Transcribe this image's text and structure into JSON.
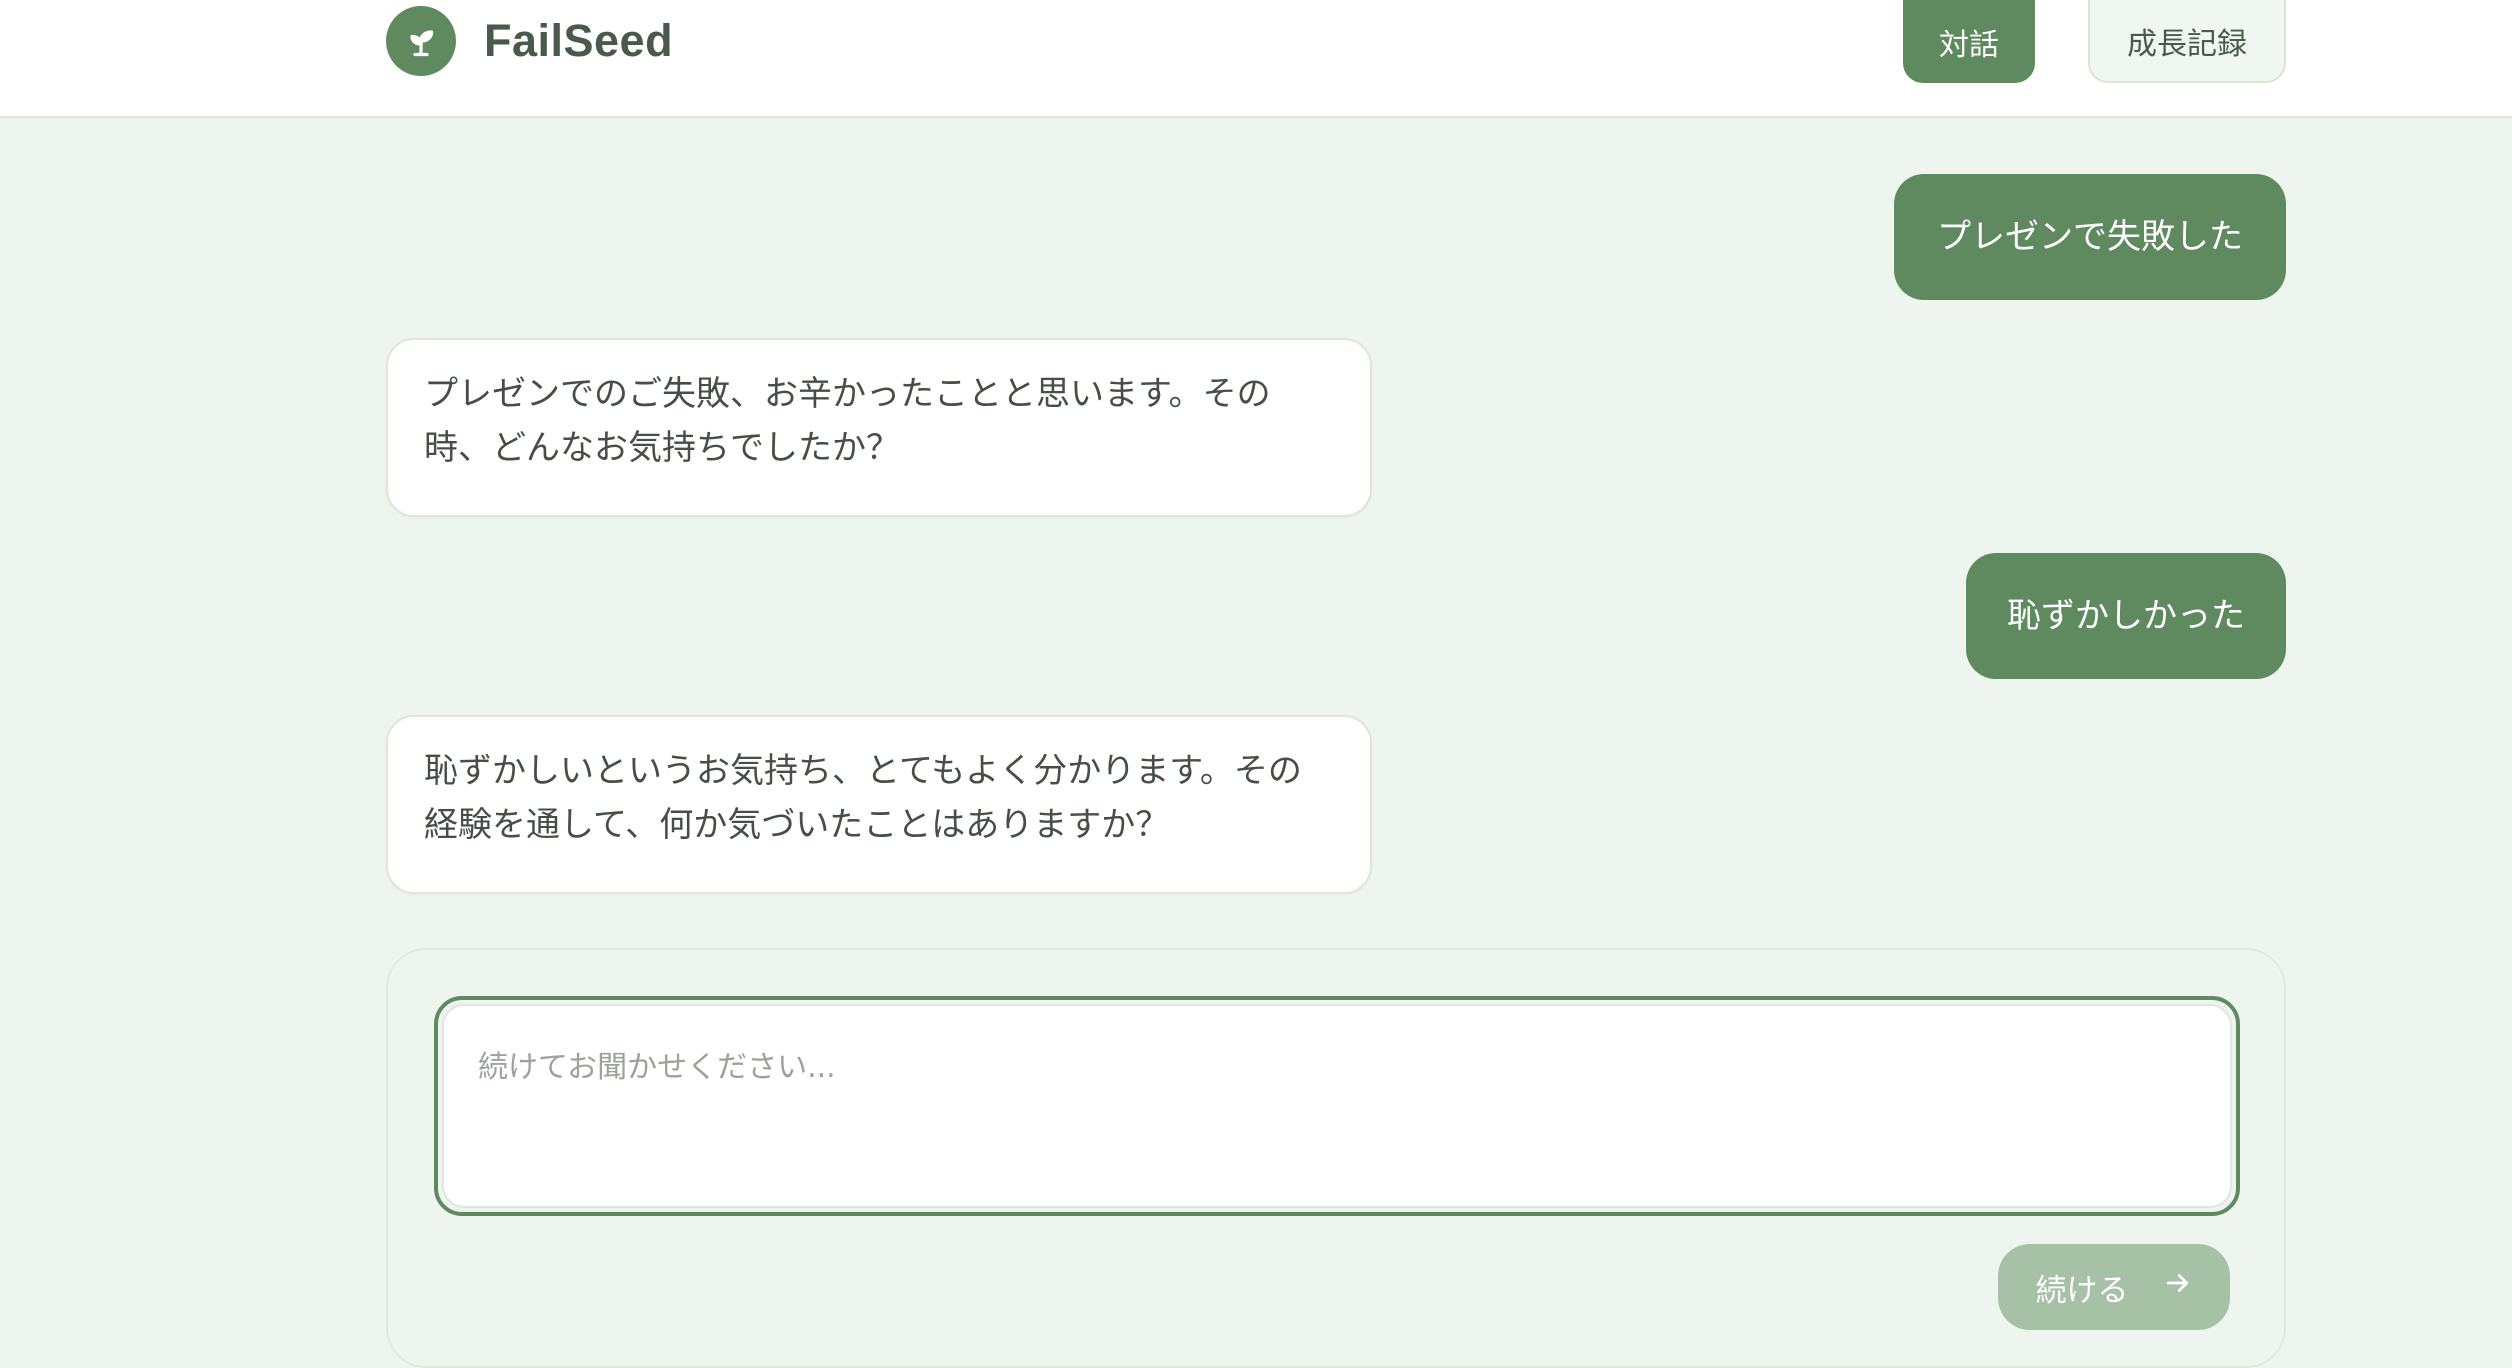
{
  "header": {
    "brand": "FailSeed",
    "logo_icon": "sprout-icon",
    "nav": [
      {
        "label": "対話",
        "active": true
      },
      {
        "label": "成長記録",
        "active": false
      }
    ]
  },
  "messages": [
    {
      "role": "user",
      "text": "プレゼンで失敗した"
    },
    {
      "role": "assistant",
      "text": "プレゼンでのご失敗、お辛かったことと思います。その時、どんなお気持ちでしたか？"
    },
    {
      "role": "user",
      "text": "恥ずかしかった"
    },
    {
      "role": "assistant",
      "text": "恥ずかしいというお気持ち、とてもよく分かります。その経験を通して、何か気づいたことはありますか？"
    }
  ],
  "composer": {
    "placeholder": "続けてお聞かせください...",
    "value": "",
    "send_label": "続ける",
    "send_icon": "arrow-right-icon"
  },
  "colors": {
    "accent": "#5f8a5f",
    "background": "#eef5ee",
    "send_disabled": "#a7c1a7"
  }
}
